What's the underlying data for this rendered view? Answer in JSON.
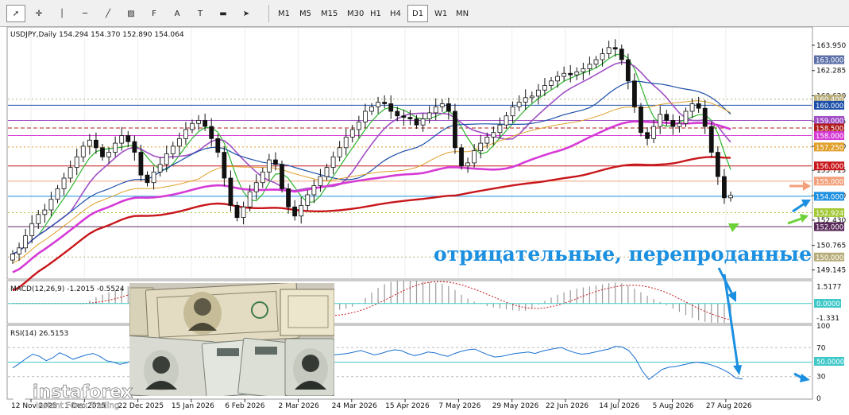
{
  "toolbar": {
    "tools": [
      {
        "name": "cursor-tool",
        "glyph": "➚"
      },
      {
        "name": "crosshair-tool",
        "glyph": "✛"
      },
      {
        "name": "vertical-line-tool",
        "glyph": "│"
      },
      {
        "name": "horizontal-line-tool",
        "glyph": "─"
      },
      {
        "name": "trendline-tool",
        "glyph": "╱"
      },
      {
        "name": "channel-tool",
        "glyph": "▨"
      },
      {
        "name": "fibonacci-tool",
        "glyph": "F"
      },
      {
        "name": "text-tool",
        "glyph": "A"
      },
      {
        "name": "label-tool",
        "glyph": "T"
      },
      {
        "name": "rectangle-tool",
        "glyph": "▬"
      },
      {
        "name": "arrows-tool",
        "glyph": "➤"
      }
    ],
    "timeframes": [
      "M1",
      "M5",
      "M15",
      "M30",
      "H1",
      "H4",
      "D1",
      "W1",
      "MN"
    ],
    "active_timeframe": "D1"
  },
  "chart_data": {
    "type": "candlestick",
    "symbol_info": "USDJPY,Daily  154.294 154.370 152.890 154.064",
    "price_axis": {
      "ylim": [
        148.6,
        165.1
      ],
      "ticks": [
        "163.950",
        "162.285",
        "160.620",
        "158.955",
        "157.290",
        "155.715",
        "154.050",
        "152.430",
        "150.765",
        "149.145"
      ]
    },
    "date_axis": [
      "12 Nov 2025",
      "1 Dec 2025",
      "22 Dec 2025",
      "15 Jan 2026",
      "6 Feb 2026",
      "2 Mar 2026",
      "24 Mar 2026",
      "15 Apr 2026",
      "7 May 2026",
      "29 May 2026",
      "22 Jun 2026",
      "14 Jul 2026",
      "5 Aug 2026",
      "27 Aug 2026"
    ],
    "close_series": [
      150.2,
      150.6,
      151.4,
      152.2,
      152.8,
      153.1,
      153.8,
      154.5,
      155.2,
      155.9,
      156.6,
      157.3,
      157.7,
      157.2,
      156.6,
      156.9,
      157.5,
      158.0,
      157.6,
      156.9,
      155.4,
      154.9,
      155.6,
      156.1,
      156.8,
      157.3,
      157.8,
      158.4,
      158.8,
      159.0,
      158.6,
      157.8,
      156.9,
      155.2,
      153.4,
      152.6,
      153.3,
      154.3,
      154.9,
      155.6,
      156.4,
      156.1,
      154.5,
      153.3,
      152.7,
      153.4,
      154.1,
      154.7,
      155.3,
      155.9,
      156.6,
      157.2,
      157.9,
      158.4,
      158.9,
      159.6,
      159.9,
      160.2,
      160.1,
      159.6,
      159.3,
      159.2,
      159.1,
      158.7,
      159.1,
      159.5,
      159.9,
      160.1,
      159.6,
      157.2,
      156.0,
      156.2,
      157.0,
      157.5,
      157.9,
      158.2,
      158.7,
      159.3,
      159.9,
      160.2,
      160.5,
      160.6,
      161.0,
      161.3,
      161.6,
      161.9,
      162.1,
      162.0,
      162.2,
      162.4,
      162.7,
      163.0,
      163.4,
      163.8,
      163.7,
      163.0,
      161.6,
      159.9,
      158.2,
      157.8,
      158.6,
      159.4,
      159.0,
      158.6,
      158.8,
      159.6,
      160.1,
      159.8,
      158.6,
      156.9,
      155.3,
      153.9,
      154.06
    ],
    "price_lines": [
      {
        "label": "163.000",
        "value": 163.0,
        "color": "#5c6fa7",
        "style": "none"
      },
      {
        "label": "160.400",
        "value": 160.4,
        "color": "#b8ad7a",
        "style": "dotted"
      },
      {
        "label": "160.000",
        "value": 160.0,
        "color": "#1c4fa8",
        "style": "solid"
      },
      {
        "label": "159.000",
        "value": 159.0,
        "color": "#a04fc4",
        "style": "solid"
      },
      {
        "label": "158.500",
        "value": 158.5,
        "color": "#b01c1c",
        "style": "dashed"
      },
      {
        "label": "158.000",
        "value": 158.0,
        "color": "#d63bd6",
        "style": "solid"
      },
      {
        "label": "157.250",
        "value": 157.25,
        "color": "#e0a02a",
        "style": "dotted"
      },
      {
        "label": "156.000",
        "value": 156.0,
        "color": "#c8161b",
        "style": "solid"
      },
      {
        "label": "155.000",
        "value": 155.0,
        "color": "#f3a07a",
        "style": "solid"
      },
      {
        "label": "154.000",
        "value": 154.0,
        "color": "#1b8fe0",
        "style": "solid"
      },
      {
        "label": "152.924",
        "value": 152.924,
        "color": "#a3c935",
        "style": "dotted"
      },
      {
        "label": "152.000",
        "value": 152.0,
        "color": "#5a2a5a",
        "style": "solid"
      },
      {
        "label": "150.000",
        "value": 150.0,
        "color": "#b8ad7a",
        "style": "dotted"
      }
    ],
    "annotation": "отрицательные, перепроданные",
    "macd": {
      "label": "MACD(12,26,9) -1.2015 -0.5524",
      "ticks": [
        "1.5177",
        "0.0000",
        "-1.331"
      ],
      "ylim": [
        -1.75,
        2.0
      ],
      "zero_label": "0.0000"
    },
    "rsi": {
      "label": "RSI(14) 26.5153",
      "ticks": [
        "100",
        "70",
        "50",
        "30",
        "0"
      ],
      "ylim": [
        0,
        100
      ],
      "level_label": "50.0000",
      "values": [
        42,
        48,
        55,
        61,
        58,
        52,
        56,
        63,
        59,
        54,
        57,
        60,
        62,
        58,
        52,
        50,
        47,
        49,
        53,
        55,
        57,
        59,
        58,
        56,
        61,
        63,
        60,
        58,
        56,
        62,
        55,
        43,
        41,
        47,
        52,
        55,
        58,
        56,
        54,
        58,
        60,
        62,
        59,
        52,
        48,
        51,
        55,
        58,
        60,
        61,
        62,
        64,
        66,
        63,
        60,
        62,
        65,
        67,
        66,
        62,
        59,
        61,
        64,
        63,
        60,
        58,
        62,
        65,
        67,
        68,
        64,
        60,
        57,
        58,
        60,
        62,
        63,
        64,
        62,
        65,
        67,
        69,
        70,
        66,
        63,
        61,
        62,
        64,
        66,
        68,
        72,
        71,
        66,
        55,
        38,
        26,
        33,
        40,
        43,
        44,
        46,
        48,
        50,
        49,
        47,
        44,
        40,
        35,
        28,
        26.5
      ]
    }
  },
  "branding": {
    "logo_text": "instaforex",
    "logo_tagline": "Instant Forex Trading"
  }
}
